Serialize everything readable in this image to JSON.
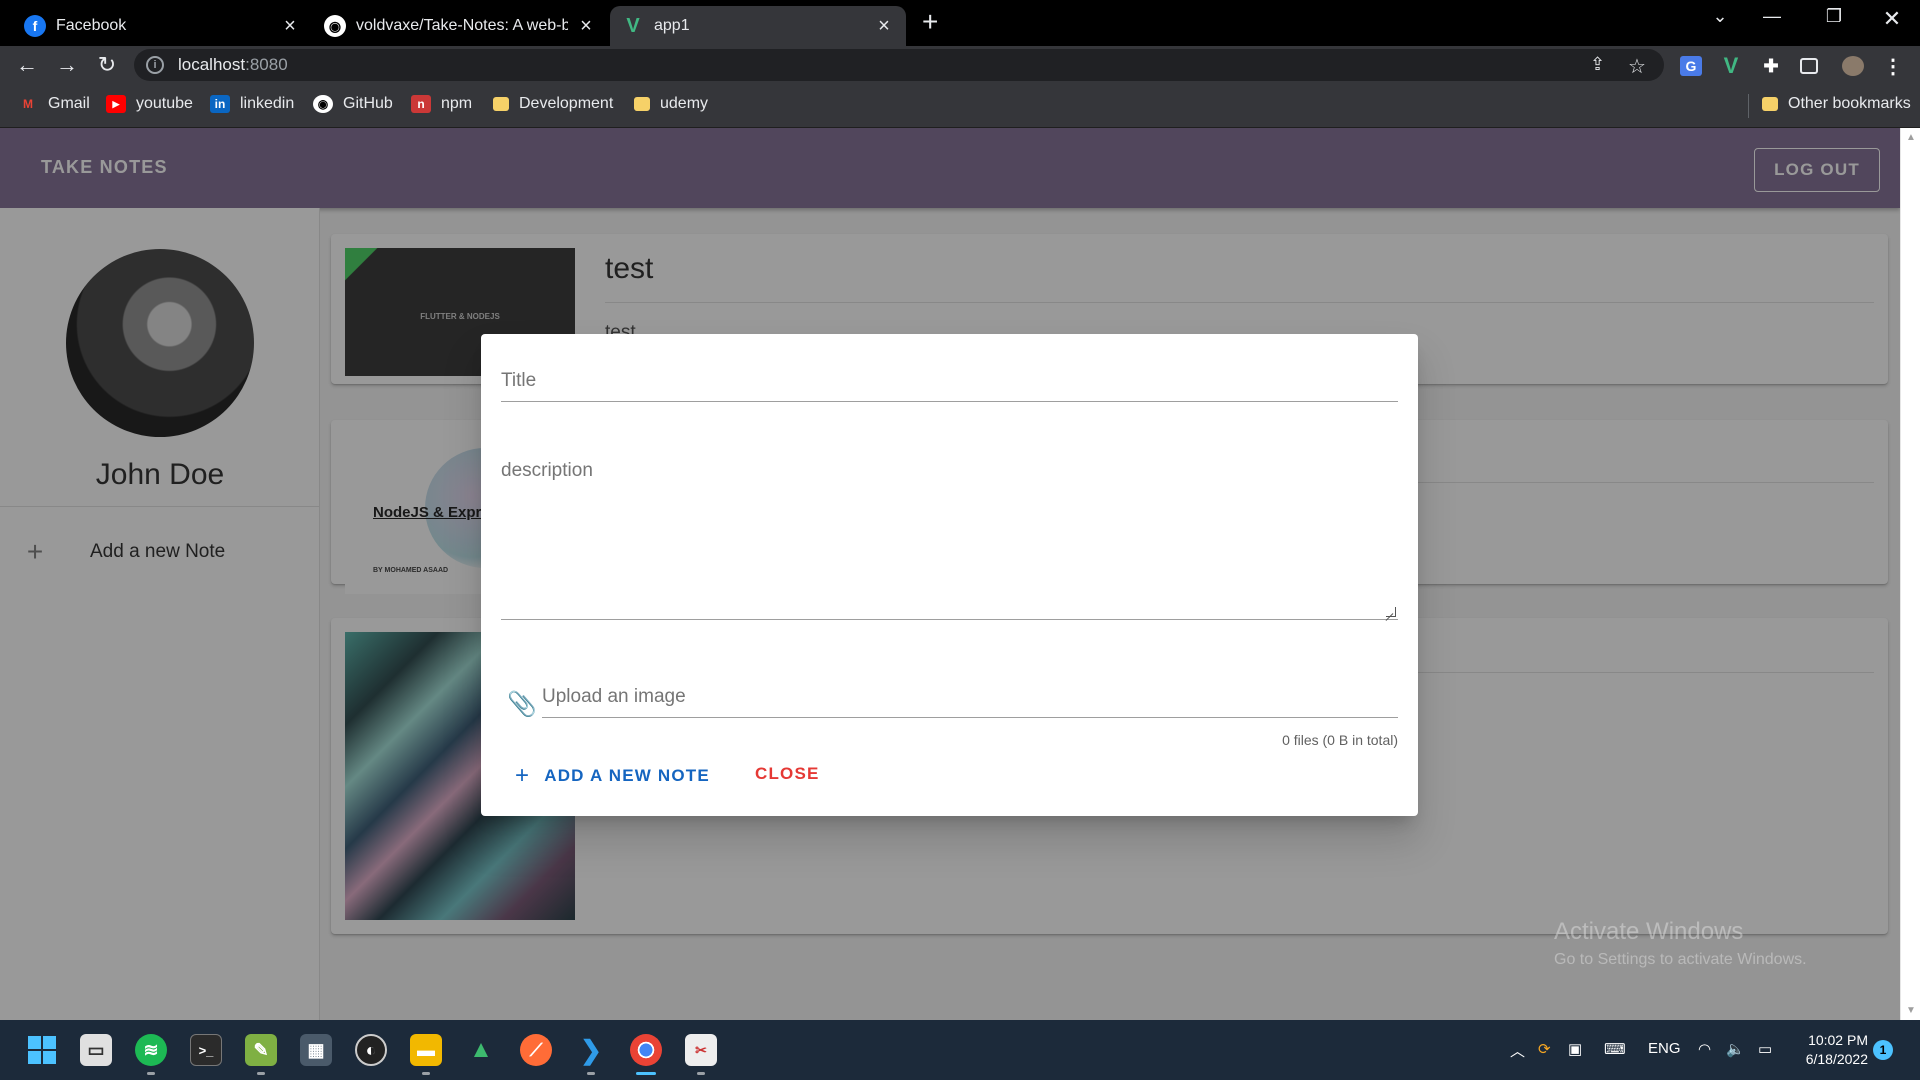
{
  "browser": {
    "tabs": [
      {
        "title": "Facebook",
        "icon": "facebook-icon",
        "color": "#1877f2"
      },
      {
        "title": "voldvaxe/Take-Notes: A web-bas",
        "icon": "github-icon"
      },
      {
        "title": "app1",
        "icon": "vue-icon",
        "color": "#41b883"
      }
    ],
    "url_host": "localhost",
    "url_port": ":8080",
    "bookmarks": [
      "Gmail",
      "youtube",
      "linkedin",
      "GitHub",
      "npm",
      "Development",
      "udemy"
    ],
    "other_bookmarks": "Other bookmarks"
  },
  "app": {
    "brand": "TAKE NOTES",
    "logout_label": "LOG OUT",
    "user_name": "John Doe",
    "add_note_label": "Add a new Note",
    "accent_color": "#7b678f",
    "notes": [
      {
        "title": "test",
        "description": "test",
        "thumb_text": "FLUTTER & NODEJS"
      },
      {
        "thumb_text": "NodeJS & Expr",
        "thumb_sub": "BY MOHAMED ASAAD"
      },
      {}
    ]
  },
  "dialog": {
    "title_placeholder": "Title",
    "description_placeholder": "description",
    "file_placeholder": "Upload an image",
    "file_hint": "0 files (0 B in total)",
    "add_button": "ADD A NEW NOTE",
    "close_button": "CLOSE"
  },
  "watermark": {
    "line1": "Activate Windows",
    "line2": "Go to Settings to activate Windows."
  },
  "taskbar": {
    "lang": "ENG",
    "time": "10:02 PM",
    "date": "6/18/2022",
    "notifications": "1"
  }
}
